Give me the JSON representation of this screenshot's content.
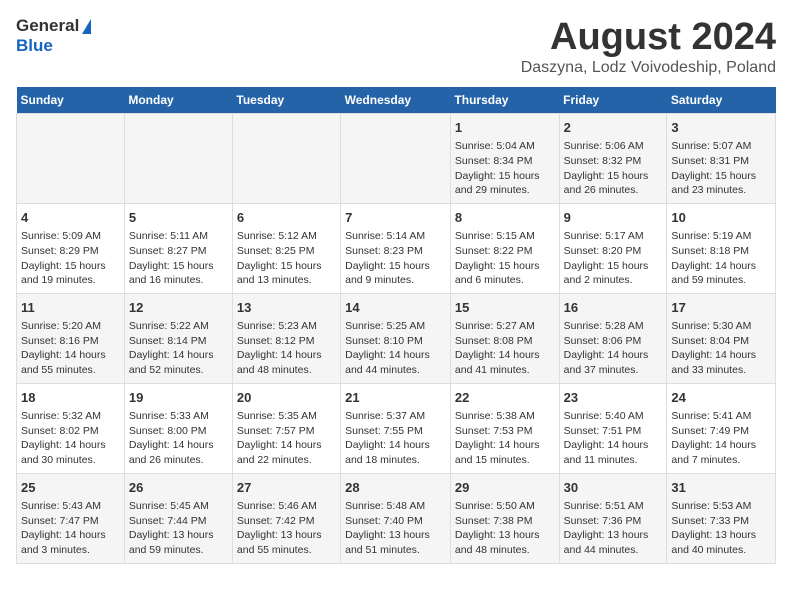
{
  "logo": {
    "general": "General",
    "blue": "Blue"
  },
  "title": "August 2024",
  "subtitle": "Daszyna, Lodz Voivodeship, Poland",
  "weekdays": [
    "Sunday",
    "Monday",
    "Tuesday",
    "Wednesday",
    "Thursday",
    "Friday",
    "Saturday"
  ],
  "weeks": [
    [
      {
        "num": "",
        "text": ""
      },
      {
        "num": "",
        "text": ""
      },
      {
        "num": "",
        "text": ""
      },
      {
        "num": "",
        "text": ""
      },
      {
        "num": "1",
        "text": "Sunrise: 5:04 AM\nSunset: 8:34 PM\nDaylight: 15 hours\nand 29 minutes."
      },
      {
        "num": "2",
        "text": "Sunrise: 5:06 AM\nSunset: 8:32 PM\nDaylight: 15 hours\nand 26 minutes."
      },
      {
        "num": "3",
        "text": "Sunrise: 5:07 AM\nSunset: 8:31 PM\nDaylight: 15 hours\nand 23 minutes."
      }
    ],
    [
      {
        "num": "4",
        "text": "Sunrise: 5:09 AM\nSunset: 8:29 PM\nDaylight: 15 hours\nand 19 minutes."
      },
      {
        "num": "5",
        "text": "Sunrise: 5:11 AM\nSunset: 8:27 PM\nDaylight: 15 hours\nand 16 minutes."
      },
      {
        "num": "6",
        "text": "Sunrise: 5:12 AM\nSunset: 8:25 PM\nDaylight: 15 hours\nand 13 minutes."
      },
      {
        "num": "7",
        "text": "Sunrise: 5:14 AM\nSunset: 8:23 PM\nDaylight: 15 hours\nand 9 minutes."
      },
      {
        "num": "8",
        "text": "Sunrise: 5:15 AM\nSunset: 8:22 PM\nDaylight: 15 hours\nand 6 minutes."
      },
      {
        "num": "9",
        "text": "Sunrise: 5:17 AM\nSunset: 8:20 PM\nDaylight: 15 hours\nand 2 minutes."
      },
      {
        "num": "10",
        "text": "Sunrise: 5:19 AM\nSunset: 8:18 PM\nDaylight: 14 hours\nand 59 minutes."
      }
    ],
    [
      {
        "num": "11",
        "text": "Sunrise: 5:20 AM\nSunset: 8:16 PM\nDaylight: 14 hours\nand 55 minutes."
      },
      {
        "num": "12",
        "text": "Sunrise: 5:22 AM\nSunset: 8:14 PM\nDaylight: 14 hours\nand 52 minutes."
      },
      {
        "num": "13",
        "text": "Sunrise: 5:23 AM\nSunset: 8:12 PM\nDaylight: 14 hours\nand 48 minutes."
      },
      {
        "num": "14",
        "text": "Sunrise: 5:25 AM\nSunset: 8:10 PM\nDaylight: 14 hours\nand 44 minutes."
      },
      {
        "num": "15",
        "text": "Sunrise: 5:27 AM\nSunset: 8:08 PM\nDaylight: 14 hours\nand 41 minutes."
      },
      {
        "num": "16",
        "text": "Sunrise: 5:28 AM\nSunset: 8:06 PM\nDaylight: 14 hours\nand 37 minutes."
      },
      {
        "num": "17",
        "text": "Sunrise: 5:30 AM\nSunset: 8:04 PM\nDaylight: 14 hours\nand 33 minutes."
      }
    ],
    [
      {
        "num": "18",
        "text": "Sunrise: 5:32 AM\nSunset: 8:02 PM\nDaylight: 14 hours\nand 30 minutes."
      },
      {
        "num": "19",
        "text": "Sunrise: 5:33 AM\nSunset: 8:00 PM\nDaylight: 14 hours\nand 26 minutes."
      },
      {
        "num": "20",
        "text": "Sunrise: 5:35 AM\nSunset: 7:57 PM\nDaylight: 14 hours\nand 22 minutes."
      },
      {
        "num": "21",
        "text": "Sunrise: 5:37 AM\nSunset: 7:55 PM\nDaylight: 14 hours\nand 18 minutes."
      },
      {
        "num": "22",
        "text": "Sunrise: 5:38 AM\nSunset: 7:53 PM\nDaylight: 14 hours\nand 15 minutes."
      },
      {
        "num": "23",
        "text": "Sunrise: 5:40 AM\nSunset: 7:51 PM\nDaylight: 14 hours\nand 11 minutes."
      },
      {
        "num": "24",
        "text": "Sunrise: 5:41 AM\nSunset: 7:49 PM\nDaylight: 14 hours\nand 7 minutes."
      }
    ],
    [
      {
        "num": "25",
        "text": "Sunrise: 5:43 AM\nSunset: 7:47 PM\nDaylight: 14 hours\nand 3 minutes."
      },
      {
        "num": "26",
        "text": "Sunrise: 5:45 AM\nSunset: 7:44 PM\nDaylight: 13 hours\nand 59 minutes."
      },
      {
        "num": "27",
        "text": "Sunrise: 5:46 AM\nSunset: 7:42 PM\nDaylight: 13 hours\nand 55 minutes."
      },
      {
        "num": "28",
        "text": "Sunrise: 5:48 AM\nSunset: 7:40 PM\nDaylight: 13 hours\nand 51 minutes."
      },
      {
        "num": "29",
        "text": "Sunrise: 5:50 AM\nSunset: 7:38 PM\nDaylight: 13 hours\nand 48 minutes."
      },
      {
        "num": "30",
        "text": "Sunrise: 5:51 AM\nSunset: 7:36 PM\nDaylight: 13 hours\nand 44 minutes."
      },
      {
        "num": "31",
        "text": "Sunrise: 5:53 AM\nSunset: 7:33 PM\nDaylight: 13 hours\nand 40 minutes."
      }
    ]
  ]
}
